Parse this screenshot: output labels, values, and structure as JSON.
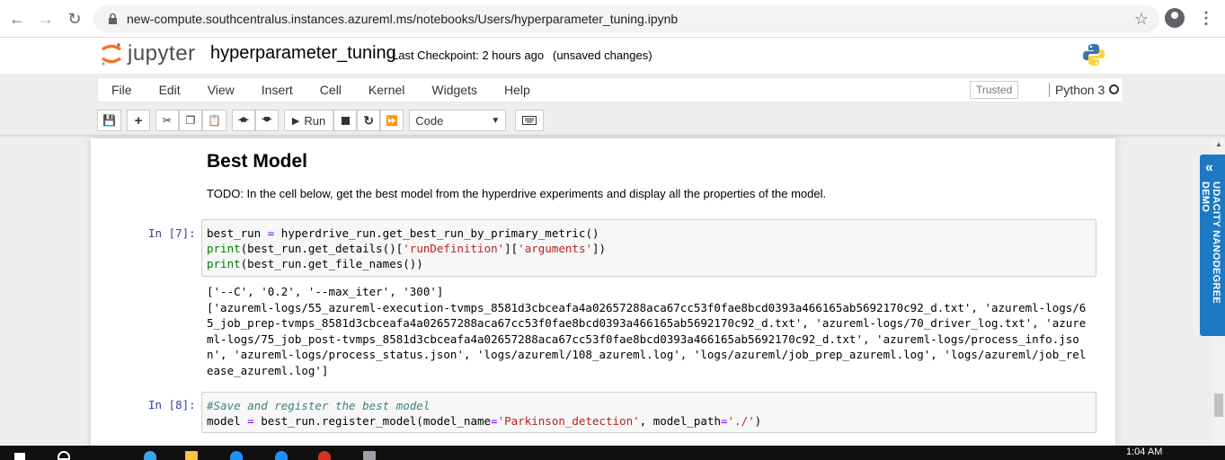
{
  "browser": {
    "url": "new-compute.southcentralus.instances.azureml.ms/notebooks/Users/hyperparameter_tuning.ipynb"
  },
  "header": {
    "logo_text": "jupyter",
    "notebook_name": "hyperparameter_tuning",
    "checkpoint": "Last Checkpoint: 2 hours ago",
    "unsaved": "(unsaved changes)"
  },
  "menu": {
    "items": [
      "File",
      "Edit",
      "View",
      "Insert",
      "Cell",
      "Kernel",
      "Widgets",
      "Help"
    ],
    "trusted": "Trusted",
    "kernel": "Python 3"
  },
  "toolbar": {
    "run_label": "Run",
    "cell_type": "Code"
  },
  "markdown": {
    "heading": "Best Model",
    "todo": "TODO: In the cell below, get the best model from the hyperdrive experiments and display all the properties of the model."
  },
  "cells": [
    {
      "prompt": "In [7]:",
      "lines": [
        "best_run = hyperdrive_run.get_best_run_by_primary_metric()",
        "print(best_run.get_details()['runDefinition']['arguments'])",
        "print(best_run.get_file_names())"
      ],
      "output": "['--C', '0.2', '--max_iter', '300']\n['azureml-logs/55_azureml-execution-tvmps_8581d3cbceafa4a02657288aca67cc53f0fae8bcd0393a466165ab5692170c92_d.txt', 'azureml-logs/65_job_prep-tvmps_8581d3cbceafa4a02657288aca67cc53f0fae8bcd0393a466165ab5692170c92_d.txt', 'azureml-logs/70_driver_log.txt', 'azureml-logs/75_job_post-tvmps_8581d3cbceafa4a02657288aca67cc53f0fae8bcd0393a466165ab5692170c92_d.txt', 'azureml-logs/process_info.json', 'azureml-logs/process_status.json', 'logs/azureml/108_azureml.log', 'logs/azureml/job_prep_azureml.log', 'logs/azureml/job_release_azureml.log']"
    },
    {
      "prompt": "In [8]:",
      "lines": [
        "#Save and register the best model",
        "model = best_run.register_model(model_name='Parkinson_detection', model_path='./')"
      ]
    }
  ],
  "side_tab": {
    "label": "UDACITY NANODEGREE DEMO"
  },
  "taskbar": {
    "time": "1:04 AM"
  },
  "colors": {
    "prompt": "#303F9F",
    "accent": "#1e79c5"
  }
}
